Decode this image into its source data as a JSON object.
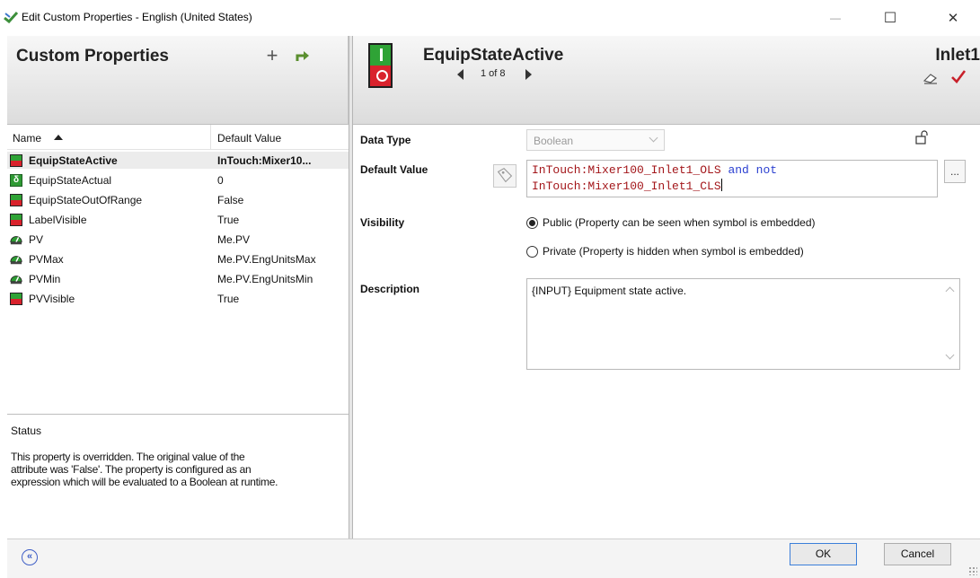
{
  "window": {
    "title": "Edit Custom Properties - English (United States)",
    "minimize_glyph": "—",
    "maximize_glyph": "☐",
    "close_glyph": "✕"
  },
  "left_header": {
    "title": "Custom Properties",
    "add_glyph": "+"
  },
  "right_header": {
    "property_name": "EquipStateActive",
    "navigation": "1 of 8",
    "owner_name": "Inlet1"
  },
  "list": {
    "columns": [
      "Name",
      "Default Value"
    ],
    "rows": [
      {
        "name": "EquipStateActive",
        "value": "InTouch:Mixer10...",
        "icon": "boolean-icon"
      },
      {
        "name": "EquipStateActual",
        "value": "0",
        "icon": "integer-icon"
      },
      {
        "name": "EquipStateOutOfRange",
        "value": "False",
        "icon": "boolean-icon"
      },
      {
        "name": "LabelVisible",
        "value": "True",
        "icon": "boolean-icon"
      },
      {
        "name": "PV",
        "value": "Me.PV",
        "icon": "analog-icon"
      },
      {
        "name": "PVMax",
        "value": "Me.PV.EngUnitsMax",
        "icon": "analog-icon"
      },
      {
        "name": "PVMin",
        "value": "Me.PV.EngUnitsMin",
        "icon": "analog-icon"
      },
      {
        "name": "PVVisible",
        "value": "True",
        "icon": "boolean-icon"
      }
    ],
    "selected_index": 0
  },
  "status": {
    "title": "Status",
    "lines": [
      "This property is overridden. The original value of the",
      "attribute was 'False'. The property is configured as an",
      "expression which will be evaluated to a Boolean at runtime."
    ]
  },
  "form": {
    "data_type_label": "Data Type",
    "data_type_value": "Boolean",
    "default_value_label": "Default Value",
    "expression": {
      "line1_ref": "InTouch:Mixer100_Inlet1_OLS",
      "line1_kw": " and not",
      "line2_ref": "InTouch:Mixer100_Inlet1_CLS"
    },
    "ellipsis_label": "...",
    "visibility_label": "Visibility",
    "public_option": "Public (Property can be seen when symbol is embedded)",
    "private_option": "Private (Property is hidden when symbol is embedded)",
    "visibility_selected": "public",
    "description_label": "Description",
    "description_value": "{INPUT} Equipment state active."
  },
  "footer": {
    "collapse_glyph": "«",
    "ok_label": "OK",
    "cancel_label": "Cancel"
  },
  "colors": {
    "boolean_green": "#2fa336",
    "boolean_red": "#d9222c",
    "reference_text": "#a3161a",
    "keyword_text": "#2a3fd0",
    "confirm_check": "#c8202a",
    "ok_border": "#3b7fd9"
  }
}
